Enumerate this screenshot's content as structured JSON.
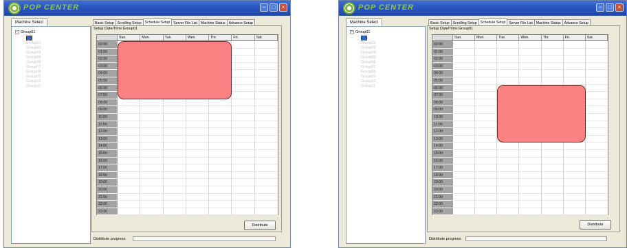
{
  "windows": [
    {
      "app_title": "POP CENTER",
      "machine_tab": "Machine Select",
      "tree": {
        "root": "Group01",
        "root_expander": "−",
        "items": [
          "Group02",
          "Group03",
          "Group04",
          "Group05",
          "Group06",
          "Group07",
          "Group08",
          "Group09",
          "Group10",
          "Group11"
        ]
      },
      "tabs": [
        {
          "label": "Basic Setup",
          "active": false
        },
        {
          "label": "Scrolling Setup",
          "active": false
        },
        {
          "label": "Schedule Setup",
          "active": true
        },
        {
          "label": "Server File List",
          "active": false
        },
        {
          "label": "Machine Status",
          "active": false
        },
        {
          "label": "Advance Setup",
          "active": false
        }
      ],
      "group_label": "Setup Date/Time:Group01",
      "days": [
        "Sun.",
        "Mon.",
        "Tue.",
        "Wen.",
        "Thr.",
        "Fri.",
        "Sat."
      ],
      "hours": [
        "00:00",
        "01:00",
        "02:00",
        "03:00",
        "04:00",
        "05:00",
        "06:00",
        "07:00",
        "08:00",
        "09:00",
        "10:00",
        "11:00",
        "12:00",
        "13:00",
        "14:00",
        "15:00",
        "16:00",
        "17:00",
        "18:00",
        "19:00",
        "20:00",
        "21:00",
        "22:00",
        "23:00"
      ],
      "schedule": {
        "start_day": "Sun.",
        "end_day": "Thr.",
        "start_time": "00:00",
        "end_time": "07:00"
      },
      "distribute_label": "Distribute",
      "progress_label": "Distribute progress:"
    },
    {
      "app_title": "POP CENTER",
      "machine_tab": "Machine Select",
      "tree": {
        "root": "Group01",
        "root_expander": "−",
        "items": [
          "Group02",
          "Group03",
          "Group04",
          "Group05",
          "Group06",
          "Group07",
          "Group08",
          "Group09",
          "Group10",
          "Group11"
        ]
      },
      "tabs": [
        {
          "label": "Basic Setup",
          "active": false
        },
        {
          "label": "Scrolling Setup",
          "active": false
        },
        {
          "label": "Schedule Setup",
          "active": true
        },
        {
          "label": "Server File List",
          "active": false
        },
        {
          "label": "Machine Status",
          "active": false
        },
        {
          "label": "Advance Setup",
          "active": false
        }
      ],
      "group_label": "Setup Date/Time:Group01",
      "days": [
        "Sun.",
        "Mon.",
        "Tue.",
        "Wen.",
        "Thr.",
        "Fri.",
        "Sat."
      ],
      "hours": [
        "00:00",
        "01:00",
        "02:00",
        "03:00",
        "04:00",
        "05:00",
        "06:00",
        "07:00",
        "08:00",
        "09:00",
        "10:00",
        "11:00",
        "12:00",
        "13:00",
        "14:00",
        "15:00",
        "16:00",
        "17:00",
        "18:00",
        "19:00",
        "20:00",
        "21:00",
        "22:00",
        "23:00"
      ],
      "schedule": {
        "start_day": "Tue.",
        "end_day": "Fri.",
        "start_time": "06:00",
        "end_time": "13:00"
      },
      "distribute_label": "Distribute",
      "progress_label": "Distribute progress:"
    }
  ],
  "colors": {
    "titlebar": "#2a56c0",
    "brand_green": "#8ec63f",
    "schedule_block": "#f98181",
    "row_header": "#a3a3a3",
    "window_bg": "#ece9d8"
  },
  "icons": [
    "app-logo-icon",
    "minimize-icon",
    "maximize-icon",
    "close-icon",
    "tree-expander-icon"
  ]
}
